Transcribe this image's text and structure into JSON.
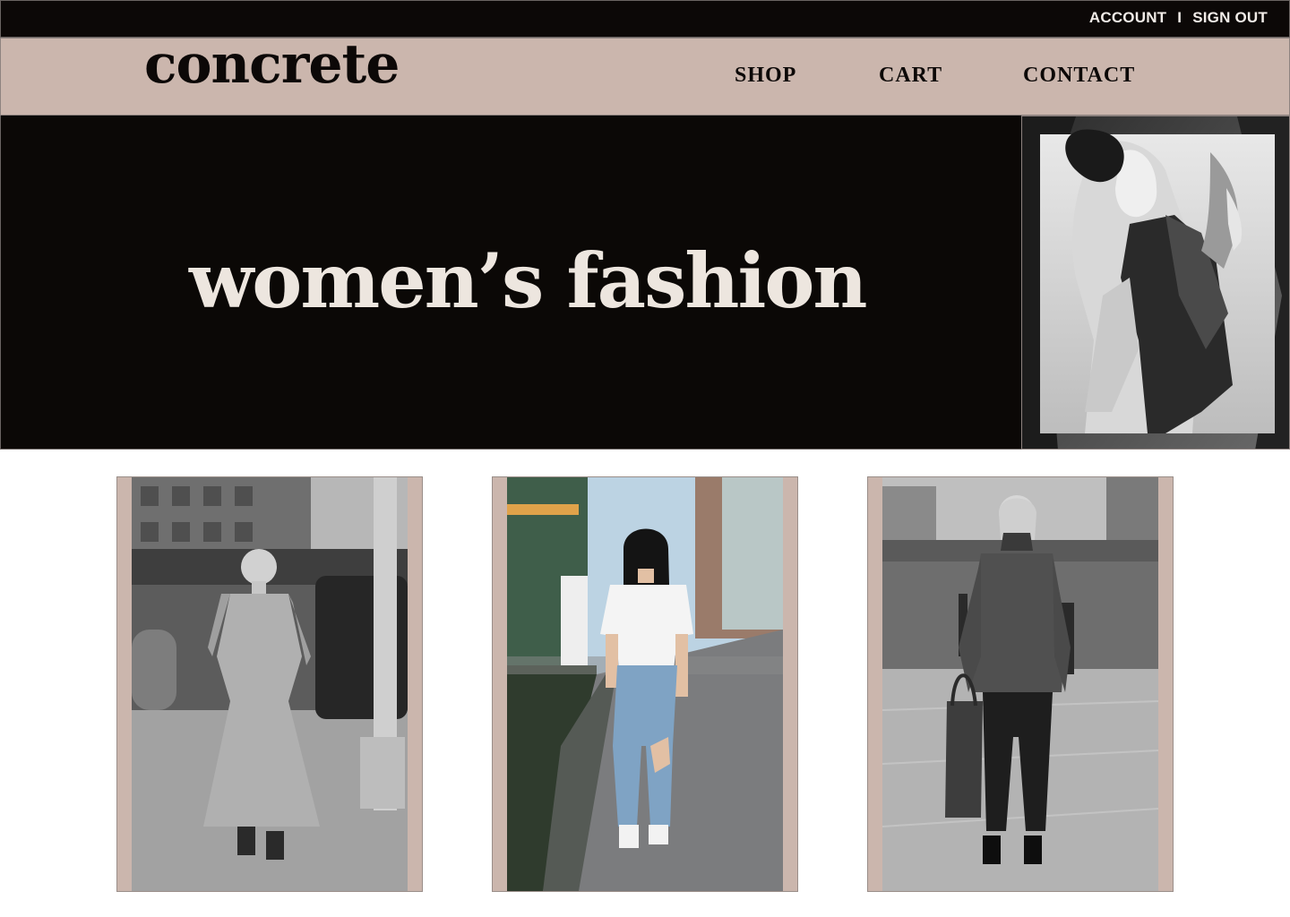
{
  "topbar": {
    "account_label": "ACCOUNT",
    "separator": "I",
    "signout_label": "SIGN OUT"
  },
  "navbar": {
    "logo": "concrete",
    "items": [
      {
        "label": "SHOP"
      },
      {
        "label": "CART"
      },
      {
        "label": "CONTACT"
      }
    ]
  },
  "hero": {
    "title": "women’s fashion"
  },
  "products": [
    {
      "photo": "woman-in-long-dress-street-photo"
    },
    {
      "photo": "woman-in-white-tee-ripped-jeans-street-photo"
    },
    {
      "photo": "woman-in-turtleneck-sweater-street-photo"
    }
  ],
  "colors": {
    "topbar_bg": "#0c0807",
    "nav_bg": "#cbb6ad",
    "hero_bg": "#0b0806",
    "hero_text": "#ede6df"
  }
}
